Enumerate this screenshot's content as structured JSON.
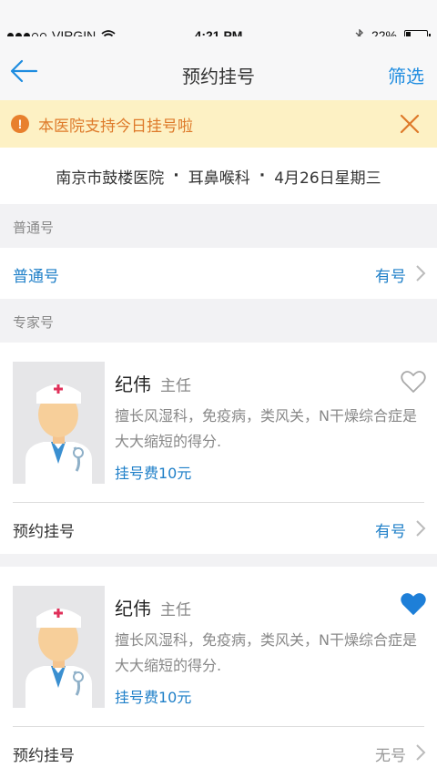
{
  "status_bar": {
    "carrier": "VIRGIN",
    "time": "4:21 PM",
    "battery_percent": "22%",
    "battery_level": 0.22
  },
  "nav": {
    "title": "预约挂号",
    "filter_label": "筛选"
  },
  "notice": {
    "text": "本医院支持今日挂号啦"
  },
  "hospital_bar": {
    "hospital": "南京市鼓楼医院",
    "department": "耳鼻喉科",
    "date": "4月26日星期三",
    "separator": "·"
  },
  "general": {
    "section_title": "普通号",
    "row_label": "普通号",
    "row_status": "有号"
  },
  "expert": {
    "section_title": "专家号",
    "doctors": [
      {
        "name": "纪伟",
        "title": "主任",
        "description": "擅长风湿科，免疫病，类风关，N干燥综合症是大大缩短的得分.",
        "fee": "挂号费10元",
        "favorited": false,
        "row_label": "预约挂号",
        "row_status": "有号"
      },
      {
        "name": "纪伟",
        "title": "主任",
        "description": "擅长风湿科，免疫病，类风关，N干燥综合症是大大缩短的得分.",
        "fee": "挂号费10元",
        "favorited": true,
        "row_label": "预约挂号",
        "row_status": "无号"
      }
    ]
  },
  "colors": {
    "accent": "#1e8ce0",
    "notice_bg": "#fdf1c4",
    "notice_text": "#de7a2a",
    "favorite": "#1e7fd8"
  }
}
